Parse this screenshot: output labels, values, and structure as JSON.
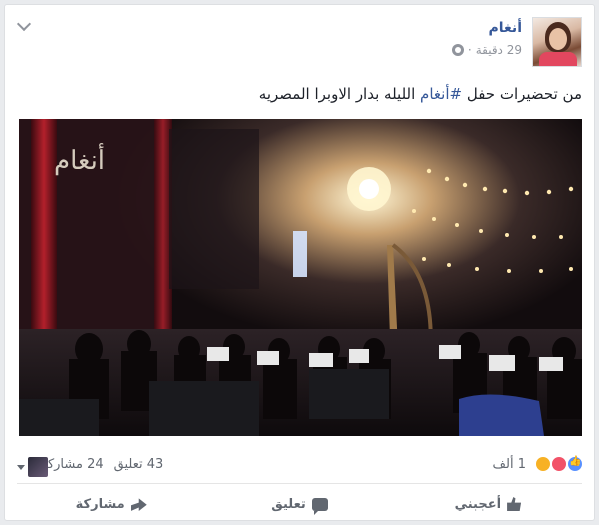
{
  "post": {
    "author": "أنغام",
    "time": "29 دقيقة",
    "separator": "·",
    "text_before": "من تحضيرات حفل ",
    "hashtag": "#أنغام",
    "text_after": " الليله بدار الاوبرا المصريه"
  },
  "photo": {
    "logo_text": "أنغام"
  },
  "reactions": {
    "count": "1 ألف",
    "comments": "43 تعليق",
    "shares": "24 مشاركة"
  },
  "actions": {
    "like": "أعجبني",
    "comment": "تعليق",
    "share": "مشاركة"
  },
  "colors": {
    "link": "#365899",
    "meta": "#90949c",
    "like_blue": "#5890ff",
    "love_red": "#f25268",
    "sad_yellow": "#f7b125"
  }
}
